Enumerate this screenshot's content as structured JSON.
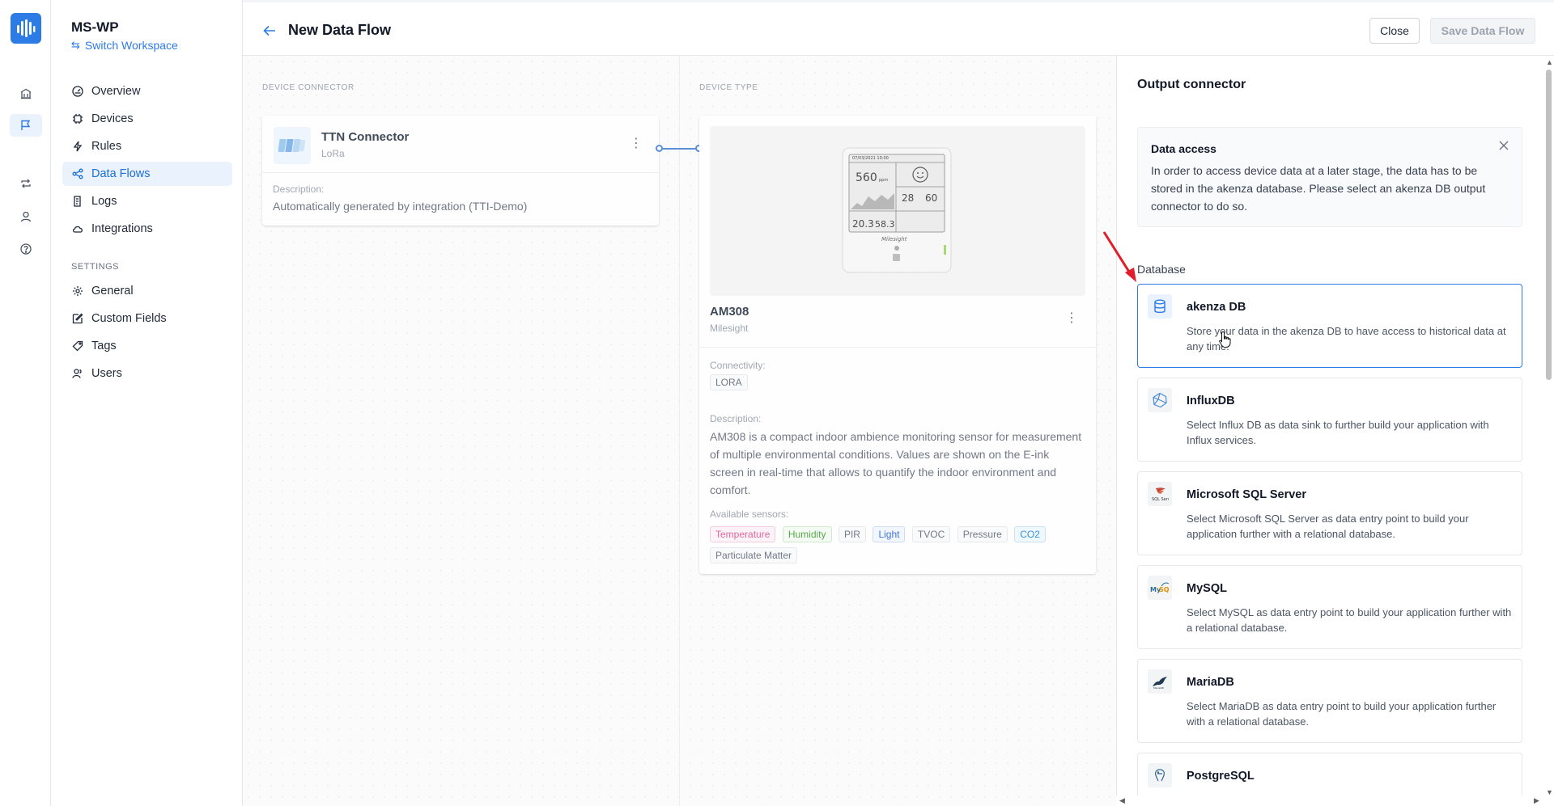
{
  "workspace": {
    "name": "MS-WP",
    "switch_label": "Switch Workspace"
  },
  "nav": {
    "items": [
      {
        "label": "Overview",
        "icon": "gauge-icon"
      },
      {
        "label": "Devices",
        "icon": "chip-icon"
      },
      {
        "label": "Rules",
        "icon": "bolt-icon"
      },
      {
        "label": "Data Flows",
        "icon": "share-icon",
        "active": true
      },
      {
        "label": "Logs",
        "icon": "log-icon"
      },
      {
        "label": "Integrations",
        "icon": "cloud-icon"
      }
    ],
    "settings_heading": "SETTINGS",
    "settings_items": [
      {
        "label": "General",
        "icon": "gear-icon"
      },
      {
        "label": "Custom Fields",
        "icon": "edit-icon"
      },
      {
        "label": "Tags",
        "icon": "tag-icon"
      },
      {
        "label": "Users",
        "icon": "users-icon"
      }
    ]
  },
  "header": {
    "title": "New Data Flow",
    "close_label": "Close",
    "save_label": "Save Data Flow"
  },
  "columns": {
    "device_connector": "DEVICE CONNECTOR",
    "device_type": "DEVICE TYPE"
  },
  "connector": {
    "name": "TTN Connector",
    "sub": "LoRa",
    "description_label": "Description:",
    "description": "Automatically generated by integration (TTI-Demo)"
  },
  "device": {
    "name": "AM308",
    "vendor": "Milesight",
    "connectivity_label": "Connectivity:",
    "connectivity": "LORA",
    "description_label": "Description:",
    "description": "AM308 is a compact indoor ambience monitoring sensor for measurement of multiple environmental conditions. Values are shown on the E-ink screen in real-time that allows to quantify the indoor environment and comfort.",
    "sensors_label": "Available sensors:",
    "sensors": [
      {
        "label": "Temperature",
        "color": "#e0609a"
      },
      {
        "label": "Humidity",
        "color": "#52a447"
      },
      {
        "label": "PIR",
        "color": "#6b7280"
      },
      {
        "label": "Light",
        "color": "#3b6fd8"
      },
      {
        "label": "TVOC",
        "color": "#6b7280"
      },
      {
        "label": "Pressure",
        "color": "#6b7280"
      },
      {
        "label": "CO2",
        "color": "#2d8fd8"
      },
      {
        "label": "Particulate Matter",
        "color": "#6b7280"
      }
    ],
    "screen": {
      "date": "07/03/2021 10:00",
      "co2": "560",
      "co2_unit": "ppm",
      "temp": "20.3",
      "hum": "58.3",
      "p1": "28",
      "p2": "60",
      "brand": "Milesight"
    }
  },
  "output": {
    "title": "Output connector",
    "notice": {
      "title": "Data access",
      "body": "In order to access device data at a later stage, the data has to be stored in the akenza database. Please select an akenza DB output connector to do so."
    },
    "database_heading": "Database",
    "options": [
      {
        "name": "akenza DB",
        "desc": "Store your data in the akenza DB to have access to historical data at any time.",
        "icon": "database-icon",
        "selected": true
      },
      {
        "name": "InfluxDB",
        "desc": "Select Influx DB as data sink to further build your application with Influx services.",
        "icon": "influxdb-icon"
      },
      {
        "name": "Microsoft SQL Server",
        "desc": "Select Microsoft SQL Server as data entry point to build your application further with a relational database.",
        "icon": "sql-server-icon"
      },
      {
        "name": "MySQL",
        "desc": "Select MySQL as data entry point to build your application further with a relational database.",
        "icon": "mysql-icon"
      },
      {
        "name": "MariaDB",
        "desc": "Select MariaDB as data entry point to build your application further with a relational database.",
        "icon": "mariadb-icon"
      },
      {
        "name": "PostgreSQL",
        "desc": "",
        "icon": "postgresql-icon"
      }
    ]
  },
  "colors": {
    "accent": "#2d7be5",
    "annotation": "#e11d2a"
  }
}
